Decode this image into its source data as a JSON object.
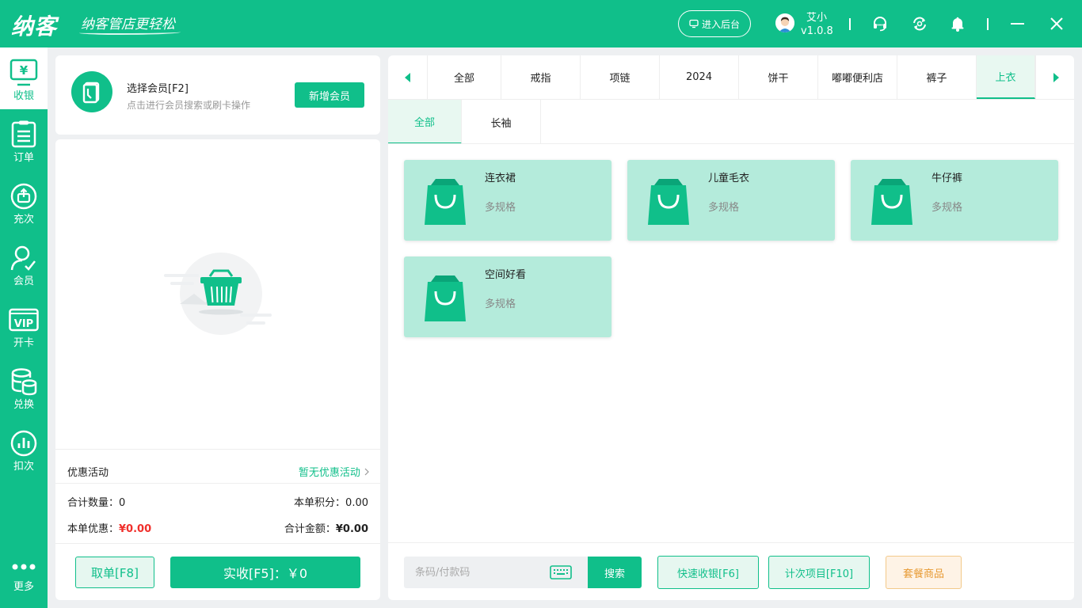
{
  "app": {
    "logo": "纳客",
    "slogan": "纳客管店更轻松",
    "backend_button": "进入后台",
    "user_name": "艾小",
    "version": "v1.0.8"
  },
  "sidebar": {
    "items": [
      {
        "label": "收银",
        "icon": "cashier-icon",
        "active": true
      },
      {
        "label": "订单",
        "icon": "order-icon"
      },
      {
        "label": "充次",
        "icon": "recharge-icon"
      },
      {
        "label": "会员",
        "icon": "member-icon"
      },
      {
        "label": "开卡",
        "icon": "vip-card-icon"
      },
      {
        "label": "兑换",
        "icon": "exchange-icon"
      },
      {
        "label": "扣次",
        "icon": "deduct-icon"
      }
    ],
    "more": "更多"
  },
  "member": {
    "title": "选择会员[F2]",
    "subtitle": "点击进行会员搜索或刷卡操作",
    "new_button": "新增会员"
  },
  "promotion": {
    "label": "优惠活动",
    "value": "暂无优惠活动"
  },
  "summary": {
    "qty_label": "合计数量：",
    "qty_value": "0",
    "points_label": "本单积分：",
    "points_value": "0.00",
    "discount_label": "本单优惠：",
    "discount_value": "¥0.00",
    "total_label": "合计金额：",
    "total_value": "¥0.00"
  },
  "actions": {
    "cancel": "取单[F8]",
    "pay": "实收[F5]：￥0"
  },
  "categories": [
    "全部",
    "戒指",
    "项链",
    "2024",
    "饼干",
    "嘟嘟便利店",
    "裤子",
    "上衣"
  ],
  "active_category": "上衣",
  "subcategories": [
    "全部",
    "长袖"
  ],
  "active_subcategory": "全部",
  "products": [
    {
      "name": "连衣裙",
      "spec": "多规格"
    },
    {
      "name": "儿童毛衣",
      "spec": "多规格"
    },
    {
      "name": "牛仔裤",
      "spec": "多规格"
    },
    {
      "name": "空间好看",
      "spec": "多规格"
    }
  ],
  "bottom": {
    "search_placeholder": "条码/付款码",
    "search_button": "搜索",
    "quick_cashier": "快速收银[F6]",
    "count_items": "计次项目[F10]",
    "combo": "套餐商品"
  },
  "colors": {
    "primary": "#10bf8a",
    "card_bg": "#b4ebdb",
    "discount": "#f0302c",
    "combo": "#e79a33"
  }
}
